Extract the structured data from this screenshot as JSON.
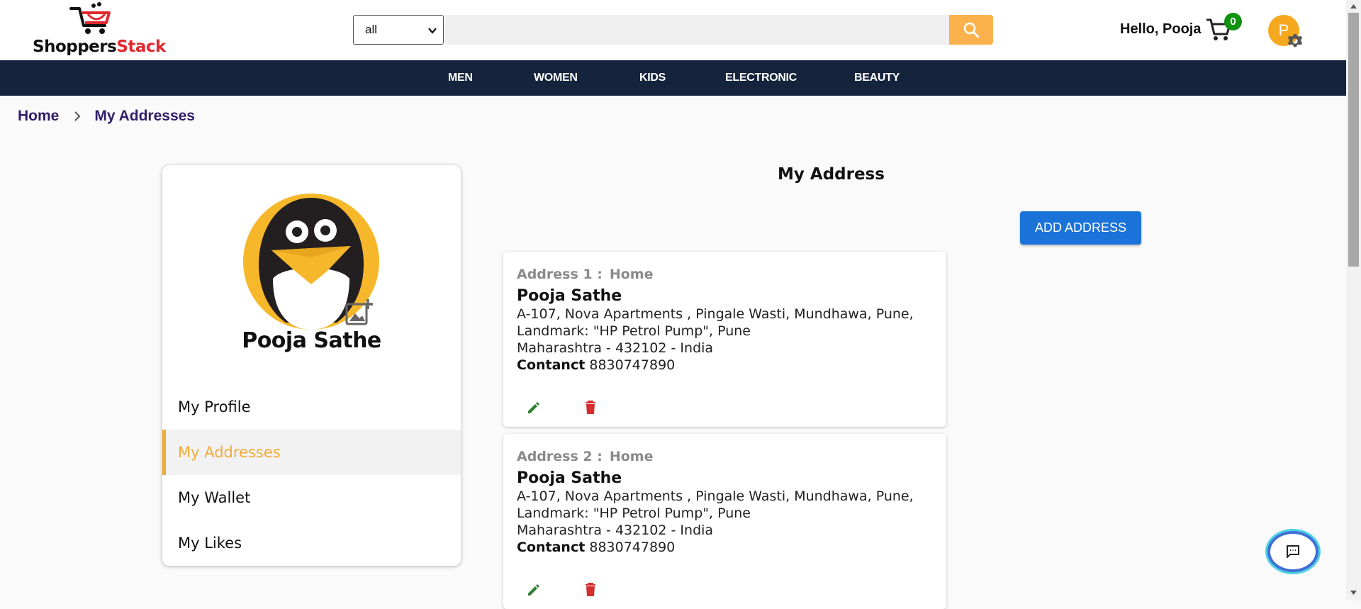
{
  "logo": {
    "text_part1": "Shoppers",
    "text_part2": "Stack",
    "icon": "shopping-cart-logo-icon"
  },
  "search": {
    "category": "all",
    "placeholder": "",
    "button_icon": "search-icon"
  },
  "header": {
    "greeting": "Hello, Pooja",
    "cart_count": "0",
    "avatar_initial": "P"
  },
  "nav": {
    "items": [
      "MEN",
      "WOMEN",
      "KIDS",
      "ELECTRONIC",
      "BEAUTY"
    ]
  },
  "breadcrumb": {
    "home": "Home",
    "current": "My Addresses"
  },
  "sidebar": {
    "name": "Pooja Sathe",
    "items": [
      {
        "label": "My Profile",
        "active": false
      },
      {
        "label": "My Addresses",
        "active": true
      },
      {
        "label": "My Wallet",
        "active": false
      },
      {
        "label": "My Likes",
        "active": false
      }
    ]
  },
  "main": {
    "title": "My Address",
    "add_button": "ADD ADDRESS",
    "contact_label": "Contanct",
    "addresses": [
      {
        "label": "Address 1 :",
        "type": "Home",
        "name": "Pooja Sathe",
        "line1": "A-107, Nova Apartments , Pingale Wasti, Mundhawa, Pune,",
        "line2": "Landmark: \"HP Petrol Pump\", Pune",
        "line3": "Maharashtra - 432102 - India",
        "contact": "8830747890"
      },
      {
        "label": "Address 2 :",
        "type": "Home",
        "name": "Pooja Sathe",
        "line1": "A-107, Nova Apartments , Pingale Wasti, Mundhawa, Pune,",
        "line2": "Landmark: \"HP Petrol Pump\", Pune",
        "line3": "Maharashtra - 432102 - India",
        "contact": "8830747890"
      }
    ]
  },
  "colors": {
    "brand_red": "#e0282e",
    "accent_orange": "#f3a93a",
    "nav_bg": "#16233d",
    "primary_blue": "#1a73d9",
    "edit_green": "#2e7d32",
    "delete_red": "#d32f2f"
  }
}
